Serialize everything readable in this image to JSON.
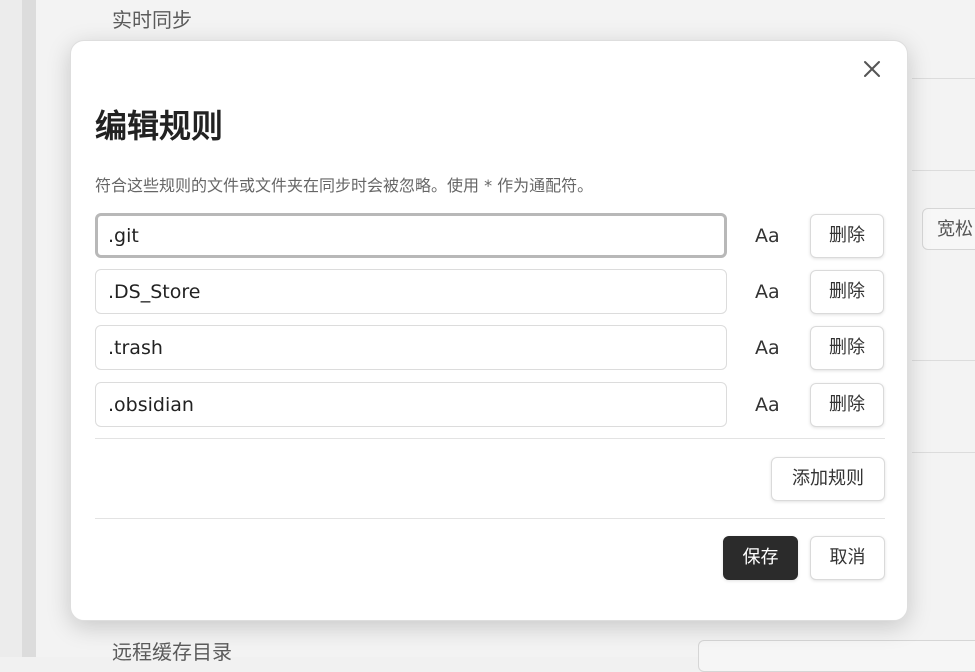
{
  "background": {
    "section_top": "实时同步",
    "section_bottom": "远程缓存目录",
    "side_button_label": "宽松"
  },
  "modal": {
    "close_icon": "close-icon",
    "title": "编辑规则",
    "description": "符合这些规则的文件或文件夹在同步时会被忽略。使用 * 作为通配符。",
    "rules": [
      {
        "value": ".git",
        "case_label": "Aa",
        "delete_label": "删除"
      },
      {
        "value": ".DS_Store",
        "case_label": "Aa",
        "delete_label": "删除"
      },
      {
        "value": ".trash",
        "case_label": "Aa",
        "delete_label": "删除"
      },
      {
        "value": ".obsidian",
        "case_label": "Aa",
        "delete_label": "删除"
      }
    ],
    "add_rule_label": "添加规则",
    "save_label": "保存",
    "cancel_label": "取消"
  },
  "colors": {
    "primary_button": "#2b2b2b",
    "overlay_bg": "#f1f1f1"
  }
}
